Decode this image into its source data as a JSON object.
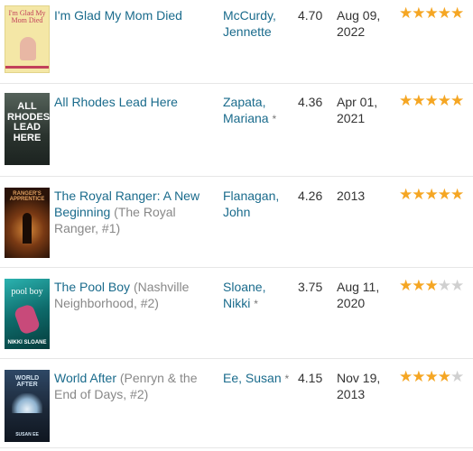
{
  "books": [
    {
      "title": "I'm Glad My Mom Died",
      "series": "",
      "author_line1": "McCurdy,",
      "author_line2": "Jennette",
      "author_mark": "",
      "rating": "4.70",
      "date_line1": "Aug 09,",
      "date_line2": "2022",
      "stars": 5,
      "cover": {
        "text": "I'm Glad My Mom Died",
        "bg": "#f4e7a6",
        "fg": "#c2405a"
      }
    },
    {
      "title": "All Rhodes Lead Here",
      "series": "",
      "author_line1": "Zapata,",
      "author_line2": "Mariana",
      "author_mark": "*",
      "rating": "4.36",
      "date_line1": "Apr 01,",
      "date_line2": "2021",
      "stars": 5,
      "cover": {
        "text": "ALL RHODES LEAD HERE",
        "bg": "#2f3b35",
        "fg": "#ffffff"
      }
    },
    {
      "title": "The Royal Ranger: A New Beginning",
      "series": "(The Royal Ranger, #1)",
      "author_line1": "Flanagan,",
      "author_line2": "John",
      "author_mark": "",
      "rating": "4.26",
      "date_line1": "2013",
      "date_line2": "",
      "stars": 5,
      "cover": {
        "text": "RANGER'S APPRENTICE",
        "bg": "#3a1d0e",
        "fg": "#e0a060"
      }
    },
    {
      "title": "The Pool Boy",
      "series": "(Nashville Neighborhood, #2)",
      "author_line1": "Sloane,",
      "author_line2": "Nikki",
      "author_mark": "*",
      "rating": "3.75",
      "date_line1": "Aug 11,",
      "date_line2": "2020",
      "stars": 3,
      "cover": {
        "text": "pool boy",
        "bg": "#0e6b6b",
        "fg": "#ffffff",
        "footer": "NIKKI SLOANE"
      }
    },
    {
      "title": "World After",
      "series": "(Penryn & the End of Days, #2)",
      "author_line1": "Ee, Susan",
      "author_line2": "",
      "author_mark": "*",
      "rating": "4.15",
      "date_line1": "Nov 19,",
      "date_line2": "2013",
      "stars": 4,
      "cover": {
        "text": "WORLD AFTER",
        "bg": "#1c2838",
        "fg": "#cfe0ee",
        "footer": "SUSAN EE"
      }
    }
  ]
}
